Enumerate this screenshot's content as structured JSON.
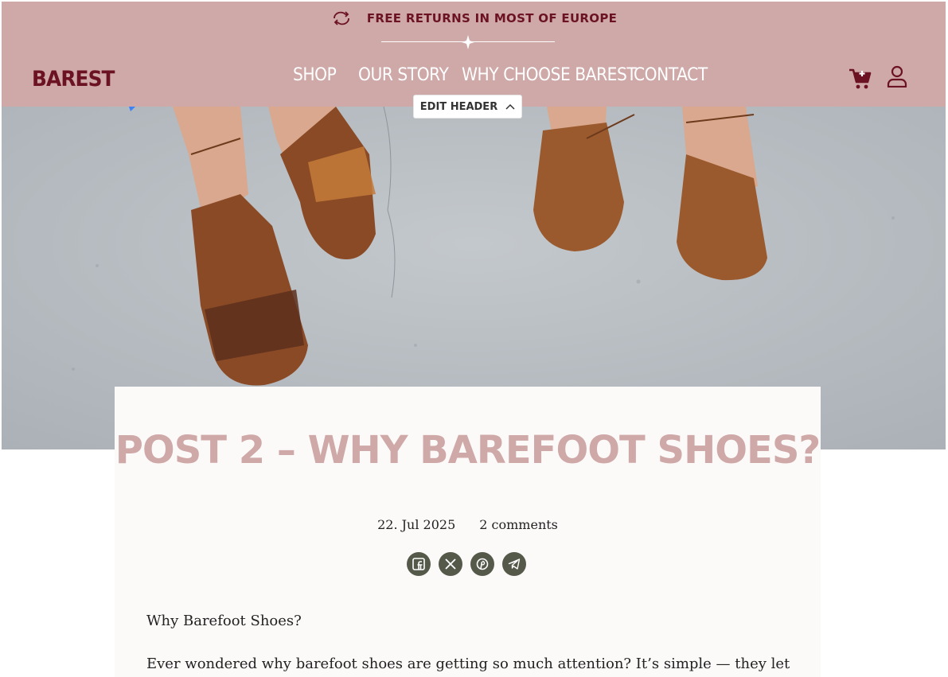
{
  "announcement": {
    "text": "FREE RETURNS IN MOST OF EUROPE",
    "icon": "returns-arrows-icon"
  },
  "brand": {
    "logo": "BAREST",
    "primary_color": "#6b1322",
    "header_bg": "#cfa8a8"
  },
  "nav": {
    "items": [
      {
        "label": "SHOP"
      },
      {
        "label": "OUR STORY"
      },
      {
        "label": "WHY CHOOSE BAREST"
      },
      {
        "label": "CONTACT"
      }
    ]
  },
  "header_actions": {
    "cart_icon": "cart-icon",
    "account_icon": "user-icon"
  },
  "editor": {
    "edit_header_label": "EDIT HEADER"
  },
  "article": {
    "title": "POST 2 – WHY BAREFOOT SHOES?",
    "date": "22. Jul 2025",
    "comments": "2 comments",
    "share": [
      "facebook-icon",
      "x-icon",
      "pinterest-icon",
      "telegram-icon"
    ],
    "paragraphs": [
      "Why Barefoot Shoes?",
      "Ever wondered why barefoot shoes are getting so much attention? It’s simple — they let"
    ]
  }
}
